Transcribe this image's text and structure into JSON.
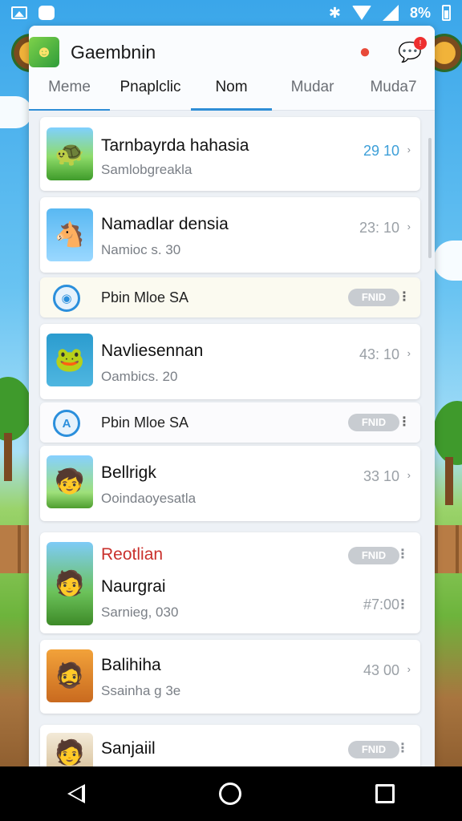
{
  "status_bar": {
    "battery_text": "8%"
  },
  "header": {
    "title": "Gaembnin"
  },
  "tabs": [
    {
      "label": "Meme"
    },
    {
      "label": "Pnaplclic"
    },
    {
      "label": "Nom"
    },
    {
      "label": "Mudar"
    },
    {
      "label": "Muda7"
    }
  ],
  "list": [
    {
      "type": "game",
      "name": "Tarnbayrda hahasia",
      "sub": "Samlobgreakla",
      "meta": "29 10"
    },
    {
      "type": "game",
      "name": "Namadlar densia",
      "sub": "Namioc s. 30",
      "meta": "23: 10"
    },
    {
      "type": "promo",
      "label": "Pbin Mloe SA",
      "badge": "FNID"
    },
    {
      "type": "game",
      "name": "Navliesennan",
      "sub": "Oambics. 20",
      "meta": "43: 10"
    },
    {
      "type": "promo",
      "label": "Pbin Mloe SA",
      "badge": "FNID"
    },
    {
      "type": "game",
      "name": "Bellrigk",
      "sub": "Ooindaoyesatla",
      "meta": "33 10"
    },
    {
      "type": "game",
      "title": "Reotlian",
      "badge": "FNID",
      "name": "Naurgrai",
      "sub": "Sarnieg, 030",
      "meta": "#7:00"
    },
    {
      "type": "game",
      "name": "Balihiha",
      "sub": "Ssainha g 3e",
      "meta": "43 00"
    },
    {
      "type": "game",
      "name": "Sanjaiil",
      "badge": "FNID"
    }
  ]
}
